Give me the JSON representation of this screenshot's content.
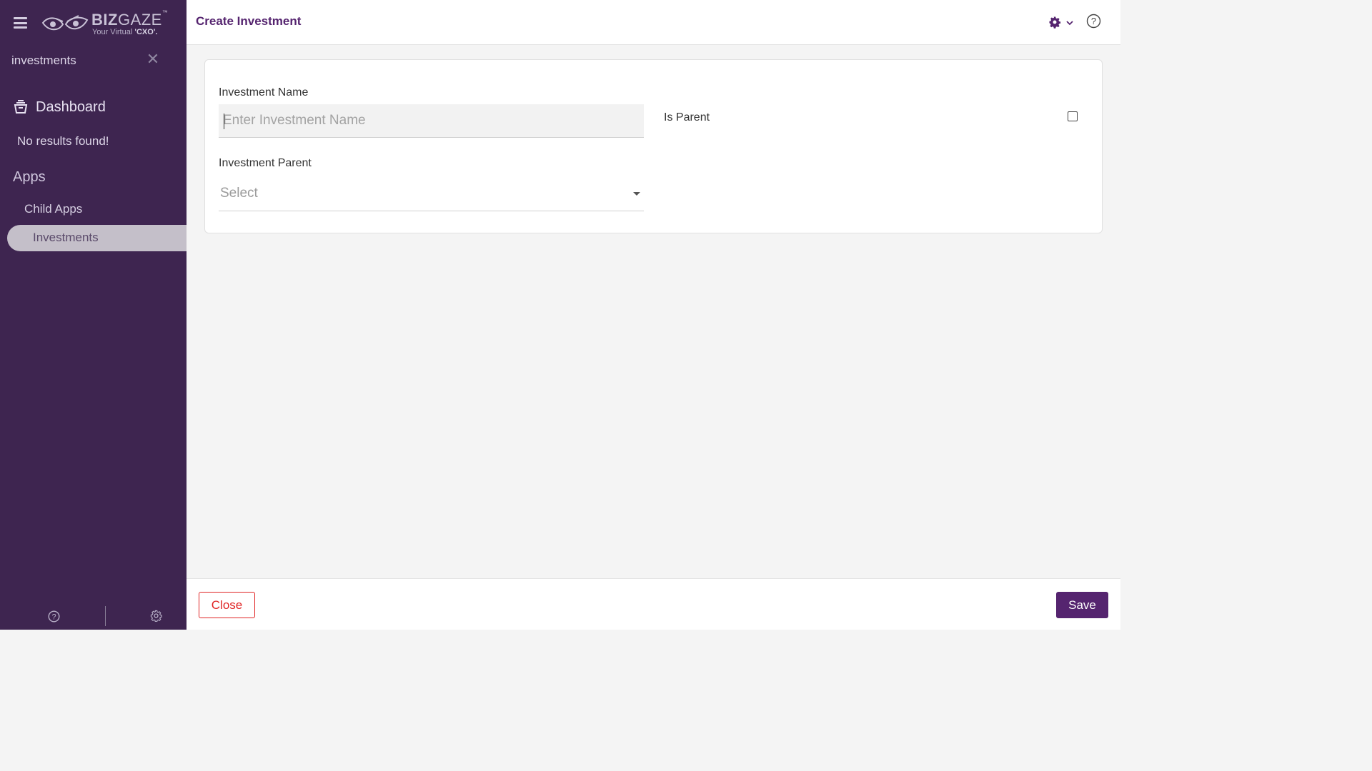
{
  "sidebar": {
    "logo": {
      "brand_bold": "BIZ",
      "brand_light": "GAZE",
      "trademark": "™",
      "tagline_prefix": "Your Virtual ",
      "tagline_bold": "'CXO'."
    },
    "search_term": "investments",
    "dashboard_label": "Dashboard",
    "no_results": "No results found!",
    "apps_heading": "Apps",
    "child_apps_label": "Child Apps",
    "investments_label": "Investments",
    "icons": {
      "menu": "hamburger-menu-icon",
      "clear": "close-icon",
      "dashboard": "dashboard-icon",
      "help": "help-icon",
      "settings": "gear-icon"
    }
  },
  "header": {
    "title": "Create Investment",
    "icons": {
      "settings": "gear-icon",
      "dropdown": "chevron-down-icon",
      "help": "help-icon"
    }
  },
  "form": {
    "investment_name_label": "Investment Name",
    "investment_name_placeholder": "Enter Investment Name",
    "investment_name_value": "",
    "is_parent_label": "Is Parent",
    "is_parent_checked": false,
    "investment_parent_label": "Investment Parent",
    "investment_parent_value": "Select"
  },
  "footer": {
    "close_label": "Close",
    "save_label": "Save"
  },
  "colors": {
    "brand_purple": "#55246f",
    "sidebar_bg": "#3e2550",
    "close_red": "#e02424"
  }
}
